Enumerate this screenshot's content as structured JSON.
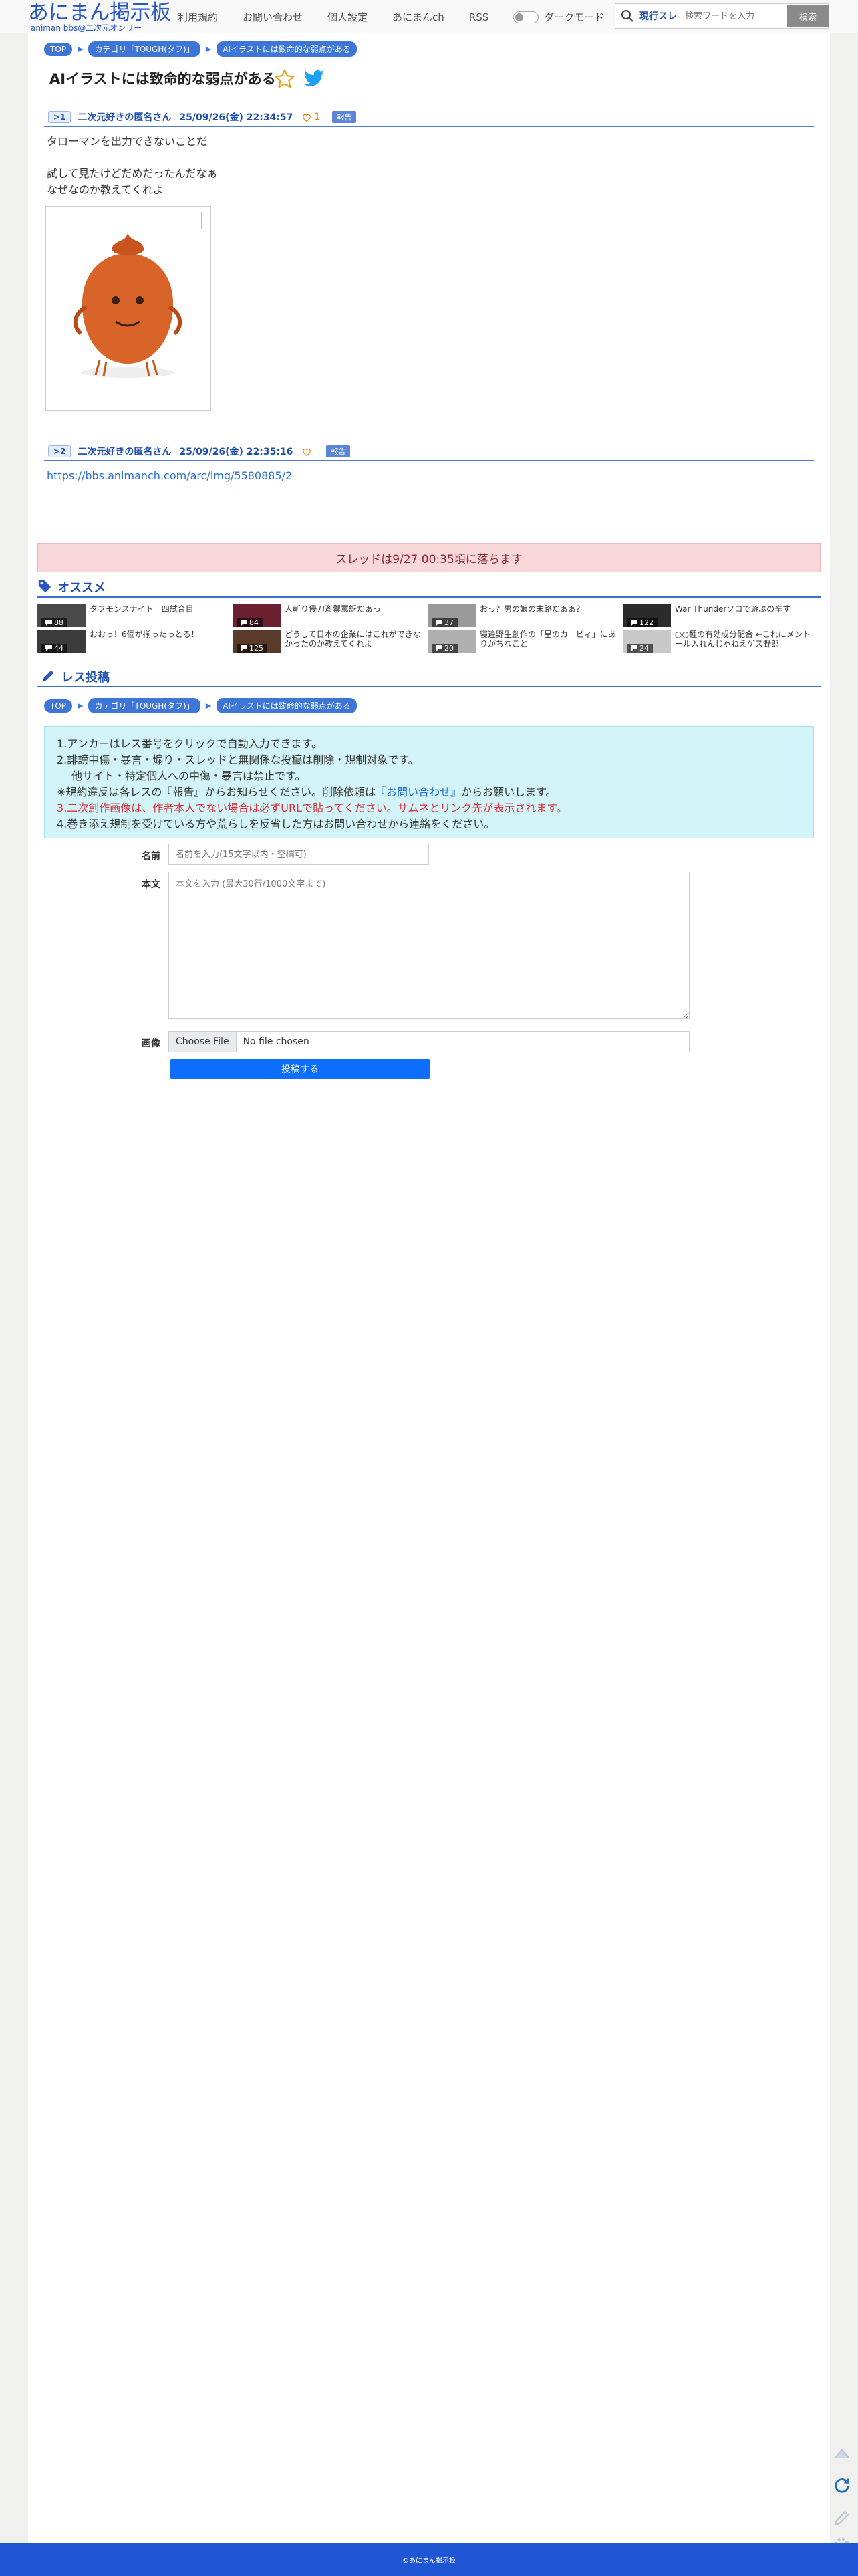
{
  "header": {
    "logo_main": "あにまん掲示板",
    "logo_sub": "animan bbs@二次元オンリー",
    "nav": [
      "利用規約",
      "お問い合わせ",
      "個人設定",
      "あにまんch",
      "RSS"
    ],
    "dark_mode_label": "ダークモード",
    "search_scope": "現行スレ",
    "search_placeholder": "検索ワードを入力",
    "search_button": "検索"
  },
  "breadcrumb": [
    "TOP",
    "カテゴリ「TOUGH(タフ)」",
    "AIイラストには致命的な弱点がある"
  ],
  "thread": {
    "title": "AIイラストには致命的な弱点がある"
  },
  "posts": [
    {
      "no": ">1",
      "name": "二次元好きの匿名さん",
      "date": "25/09/26(金) 22:34:57",
      "likes": "1",
      "report": "報告",
      "lines": [
        "タローマンを出力できないことだ",
        "",
        "試して見たけどだめだったんだなぁ",
        "なぜなのか教えてくれよ"
      ]
    },
    {
      "no": ">2",
      "name": "二次元好きの匿名さん",
      "date": "25/09/26(金) 22:35:16",
      "likes": "",
      "report": "報告",
      "link": "https://bbs.animanch.com/arc/img/5580885/2"
    }
  ],
  "notice": "スレッドは9/27 00:35頃に落ちます",
  "recommend": {
    "heading": "オススメ",
    "items": [
      {
        "title": "タフモンスナイト　四試合目",
        "count": "88",
        "thumb": "#4a4a4a"
      },
      {
        "title": "人斬り侵刀斎禦罵訝だぁっ",
        "count": "84",
        "thumb": "#6b2030"
      },
      {
        "title": "おっ？男の娘の末路だぁぁ？",
        "count": "37",
        "thumb": "#9a9a9a"
      },
      {
        "title": "War Thunderソロで遊ぶの辛す",
        "count": "122",
        "thumb": "#2b2b2b"
      },
      {
        "title": "おおっ！6個が揃ったっとる！",
        "count": "44",
        "thumb": "#3b3b3b"
      },
      {
        "title": "どうして日本の企業にはこれができなかったのか教えてくれよ",
        "count": "125",
        "thumb": "#5a3a2a"
      },
      {
        "title": "寝違野生創作の「星のカービィ」にありがちなこと",
        "count": "20",
        "thumb": "#b0b0b0"
      },
      {
        "title": "○○種の有効成分配合 ←これにメントール入れんじゃねえゲス野郎",
        "count": "24",
        "thumb": "#c8c8c8"
      }
    ]
  },
  "post_form": {
    "heading": "レス投稿",
    "guide": {
      "line1": "1.アンカーはレス番号をクリックで自動入力できます。",
      "line2": "2.誹謗中傷・暴言・煽り・スレッドと無関係な投稿は削除・規制対象です。",
      "line2b": "他サイト・特定個人への中傷・暴言は禁止です。",
      "line3a": "※規約違反は各レスの『報告』からお知らせください。削除依頼は",
      "line3link": "『お問い合わせ』",
      "line3b": "からお願いします。",
      "line4": "3.二次創作画像は、作者本人でない場合は必ずURLで貼ってください。サムネとリンク先が表示されます。",
      "line5": "4.巻き添え規制を受けている方や荒らしを反省した方はお問い合わせから連絡をください。"
    },
    "name_label": "名前",
    "name_placeholder": "名前を入力(15文字以内・空欄可)",
    "body_label": "本文",
    "body_placeholder": "本文を入力 (最大30行/1000文字まで)",
    "image_label": "画像",
    "file_button": "Choose File",
    "file_status": "No file chosen",
    "submit": "投稿する"
  },
  "footer": "©あにまん掲示板",
  "colors": {
    "accent": "#2a56c6",
    "footer": "#1e56d6",
    "notice_bg": "#f8d7da",
    "guide_bg": "#d2f3f8"
  }
}
